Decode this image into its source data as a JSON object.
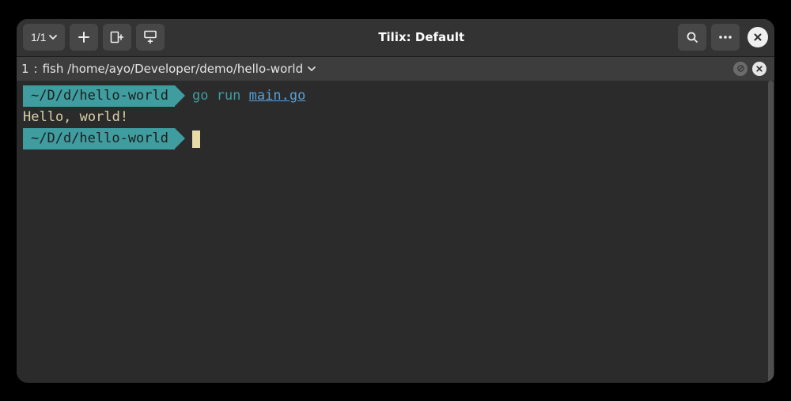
{
  "titlebar": {
    "session_indicator": "1/1",
    "title": "Tilix: Default"
  },
  "tab": {
    "index": "1",
    "label": "fish /home/ayo/Developer/demo/hello-world"
  },
  "terminal": {
    "prompt_path": "~/D/d/hello-world",
    "lines": [
      {
        "type": "command",
        "cmd_prefix": "go run ",
        "cmd_file": "main.go"
      },
      {
        "type": "output",
        "text": "Hello, world!"
      },
      {
        "type": "prompt"
      }
    ]
  },
  "colors": {
    "accent": "#3f9da0",
    "link": "#5a9fd4",
    "bg": "#2b2b2b"
  }
}
